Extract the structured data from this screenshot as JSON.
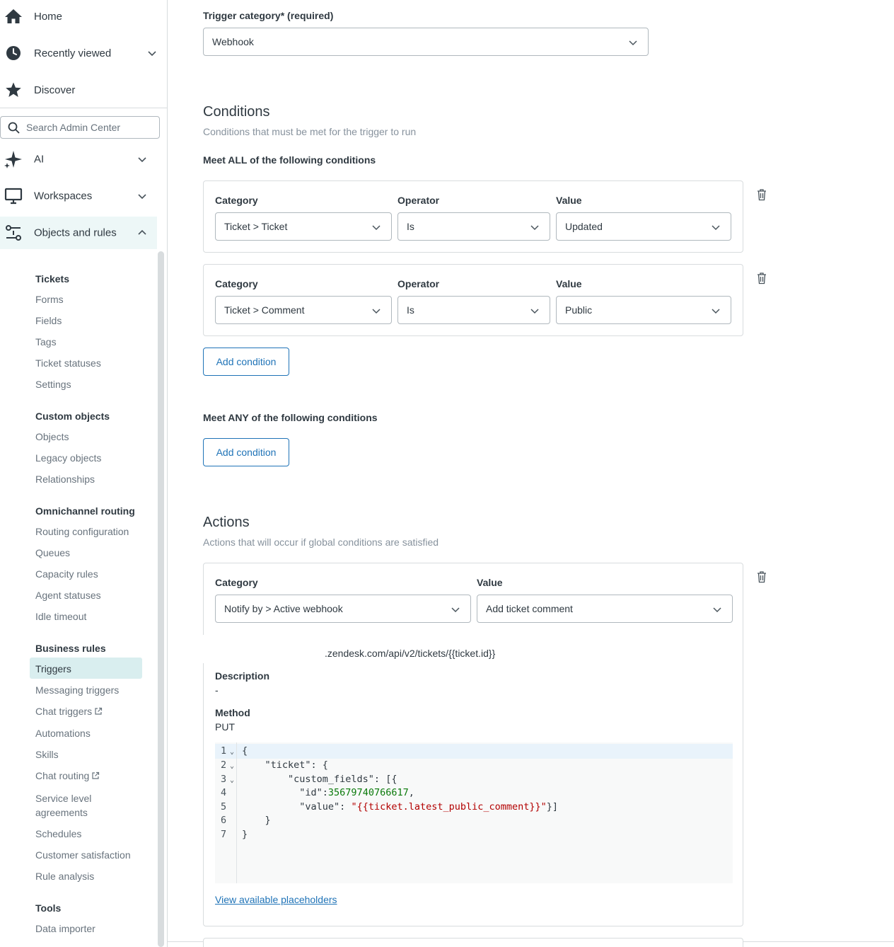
{
  "sidebar": {
    "top_items": [
      {
        "label": "Home",
        "icon": "home-icon"
      },
      {
        "label": "Recently viewed",
        "icon": "clock-icon"
      },
      {
        "label": "Discover",
        "icon": "star-icon"
      }
    ],
    "search_placeholder": "Search Admin Center",
    "sections": [
      {
        "label": "AI",
        "icon": "sparkle-icon"
      },
      {
        "label": "Workspaces",
        "icon": "monitor-icon"
      },
      {
        "label": "Objects and rules",
        "icon": "objects-rules-icon"
      }
    ],
    "groups": {
      "tickets": {
        "title": "Tickets",
        "items": [
          "Forms",
          "Fields",
          "Tags",
          "Ticket statuses",
          "Settings"
        ]
      },
      "custom_objects": {
        "title": "Custom objects",
        "items": [
          "Objects",
          "Legacy objects",
          "Relationships"
        ]
      },
      "omnichannel": {
        "title": "Omnichannel routing",
        "items": [
          "Routing configuration",
          "Queues",
          "Capacity rules",
          "Agent statuses",
          "Idle timeout"
        ]
      },
      "business_rules": {
        "title": "Business rules",
        "items": [
          "Triggers",
          "Messaging triggers",
          "Chat triggers",
          "Automations",
          "Skills",
          "Chat routing",
          "Service level",
          "agreements",
          "Schedules",
          "Customer satisfaction",
          "Rule analysis"
        ]
      },
      "tools": {
        "title": "Tools",
        "items": [
          "Data importer"
        ]
      }
    }
  },
  "main": {
    "trigger_category": {
      "label": "Trigger category* (required)",
      "value": "Webhook"
    },
    "conditions": {
      "title": "Conditions",
      "subtitle": "Conditions that must be met for the trigger to run",
      "all_title": "Meet ALL of the following conditions",
      "any_title": "Meet ANY of the following conditions",
      "col_category": "Category",
      "col_operator": "Operator",
      "col_value": "Value",
      "rows": [
        {
          "category": "Ticket > Ticket",
          "operator": "Is",
          "value": "Updated"
        },
        {
          "category": "Ticket > Comment",
          "operator": "Is",
          "value": "Public"
        }
      ],
      "add_label": "Add condition"
    },
    "actions": {
      "title": "Actions",
      "subtitle": "Actions that will occur if global conditions are satisfied",
      "col_category": "Category",
      "col_value": "Value",
      "category": "Notify by > Active webhook",
      "value": "Add ticket comment",
      "endpoint": ".zendesk.com/api/v2/tickets/{{ticket.id}}",
      "description_label": "Description",
      "description_value": "-",
      "method_label": "Method",
      "method_value": "PUT",
      "code": {
        "line_numbers": [
          "1",
          "2",
          "3",
          "4",
          "5",
          "6",
          "7"
        ],
        "l1": "{",
        "l2": "    \"ticket\": {",
        "l3": "        \"custom_fields\": [{",
        "l4_key": "          \"id\":",
        "l4_num": "35679740766617",
        "l4_end": ",",
        "l5_key": "          \"value\": ",
        "l5_str": "\"{{ticket.latest_public_comment}}\"",
        "l5_end": "}]",
        "l6": "    }",
        "l7": "}"
      },
      "placeholders_link": "View available placeholders"
    }
  }
}
